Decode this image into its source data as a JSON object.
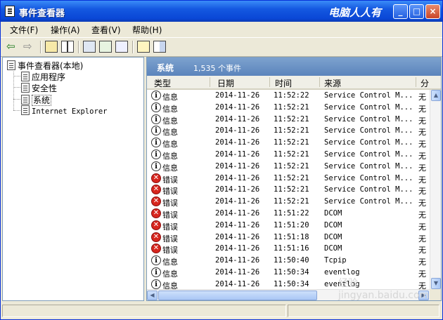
{
  "window": {
    "title": "事件查看器",
    "brand_text": "电脑人人有",
    "buttons": {
      "minimize": "_",
      "maximize": "□",
      "close": "×"
    }
  },
  "menu": [
    {
      "label": "文件(F)"
    },
    {
      "label": "操作(A)"
    },
    {
      "label": "查看(V)"
    },
    {
      "label": "帮助(H)"
    }
  ],
  "toolbar": {
    "icons": [
      "back-arrow-icon",
      "forward-arrow-icon",
      "up-folder-icon",
      "show-hide-tree-icon",
      "properties-icon",
      "refresh-icon",
      "export-icon",
      "help-icon",
      "console-icon"
    ]
  },
  "tree": {
    "root": "事件查看器(本地)",
    "items": [
      "应用程序",
      "安全性",
      "系统",
      "Internet Explorer"
    ],
    "selected": "系统"
  },
  "panel": {
    "title": "系统",
    "count": "1,535 个事件"
  },
  "columns": [
    "类型",
    "日期",
    "时间",
    "来源",
    "分"
  ],
  "events": [
    {
      "type": "信息",
      "kind": "info",
      "date": "2014-11-26",
      "time": "11:52:22",
      "source": "Service Control M...",
      "cat": "无"
    },
    {
      "type": "信息",
      "kind": "info",
      "date": "2014-11-26",
      "time": "11:52:21",
      "source": "Service Control M...",
      "cat": "无"
    },
    {
      "type": "信息",
      "kind": "info",
      "date": "2014-11-26",
      "time": "11:52:21",
      "source": "Service Control M...",
      "cat": "无"
    },
    {
      "type": "信息",
      "kind": "info",
      "date": "2014-11-26",
      "time": "11:52:21",
      "source": "Service Control M...",
      "cat": "无"
    },
    {
      "type": "信息",
      "kind": "info",
      "date": "2014-11-26",
      "time": "11:52:21",
      "source": "Service Control M...",
      "cat": "无"
    },
    {
      "type": "信息",
      "kind": "info",
      "date": "2014-11-26",
      "time": "11:52:21",
      "source": "Service Control M...",
      "cat": "无"
    },
    {
      "type": "信息",
      "kind": "info",
      "date": "2014-11-26",
      "time": "11:52:21",
      "source": "Service Control M...",
      "cat": "无"
    },
    {
      "type": "错误",
      "kind": "error",
      "date": "2014-11-26",
      "time": "11:52:21",
      "source": "Service Control M...",
      "cat": "无"
    },
    {
      "type": "错误",
      "kind": "error",
      "date": "2014-11-26",
      "time": "11:52:21",
      "source": "Service Control M...",
      "cat": "无"
    },
    {
      "type": "错误",
      "kind": "error",
      "date": "2014-11-26",
      "time": "11:52:21",
      "source": "Service Control M...",
      "cat": "无"
    },
    {
      "type": "错误",
      "kind": "error",
      "date": "2014-11-26",
      "time": "11:51:22",
      "source": "DCOM",
      "cat": "无"
    },
    {
      "type": "错误",
      "kind": "error",
      "date": "2014-11-26",
      "time": "11:51:20",
      "source": "DCOM",
      "cat": "无"
    },
    {
      "type": "错误",
      "kind": "error",
      "date": "2014-11-26",
      "time": "11:51:18",
      "source": "DCOM",
      "cat": "无"
    },
    {
      "type": "错误",
      "kind": "error",
      "date": "2014-11-26",
      "time": "11:51:16",
      "source": "DCOM",
      "cat": "无"
    },
    {
      "type": "信息",
      "kind": "info",
      "date": "2014-11-26",
      "time": "11:50:40",
      "source": "Tcpip",
      "cat": "无"
    },
    {
      "type": "信息",
      "kind": "info",
      "date": "2014-11-26",
      "time": "11:50:34",
      "source": "eventlog",
      "cat": "无"
    },
    {
      "type": "信息",
      "kind": "info",
      "date": "2014-11-26",
      "time": "11:50:34",
      "source": "eventlog",
      "cat": "无"
    }
  ],
  "watermark": "经验 jingyan.baidu.com",
  "colors": {
    "title_bar": "#0a47d6",
    "panel_header": "#6b93c6",
    "error_icon": "#d7261e",
    "face": "#ece9d8"
  }
}
